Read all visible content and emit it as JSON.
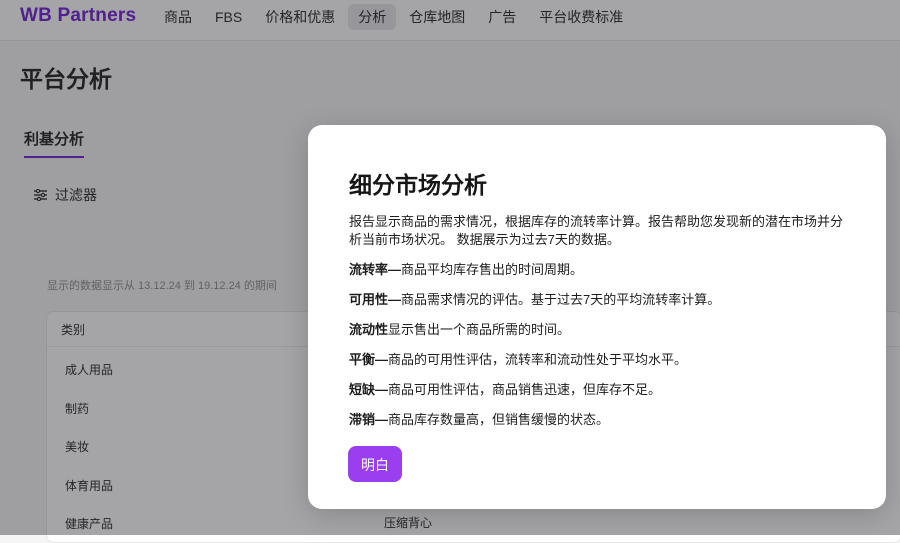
{
  "brand": "WB Partners",
  "nav": [
    {
      "label": "商品",
      "active": false
    },
    {
      "label": "FBS",
      "active": false
    },
    {
      "label": "价格和优惠",
      "active": false
    },
    {
      "label": "分析",
      "active": true
    },
    {
      "label": "仓库地图",
      "active": false
    },
    {
      "label": "广告",
      "active": false
    },
    {
      "label": "平台收费标准",
      "active": false
    }
  ],
  "page": {
    "title": "平台分析",
    "subtab": "利基分析",
    "filter_label": "过滤器",
    "date_note": "显示的数据显示从 13.12.24 到 19.12.24 的期间",
    "table": {
      "header_category": "类别",
      "rows": [
        {
          "category": "成人用品",
          "second": ""
        },
        {
          "category": "制药",
          "second": ""
        },
        {
          "category": "美妆",
          "second": ""
        },
        {
          "category": "体育用品",
          "second": ""
        },
        {
          "category": "健康产品",
          "second": "压缩背心"
        }
      ]
    }
  },
  "modal": {
    "title": "细分市场分析",
    "intro": "报告显示商品的需求情况，根据库存的流转率计算。报告帮助您发现新的潜在市场并分析当前市场状况。 数据展示为过去7天的数据。",
    "definitions": [
      {
        "term": "流转率—",
        "text": "商品平均库存售出的时间周期。"
      },
      {
        "term": "可用性—",
        "text": "商品需求情况的评估。基于过去7天的平均流转率计算。"
      },
      {
        "term": "流动性",
        "text": "显示售出一个商品所需的时间。"
      },
      {
        "term": "平衡—",
        "text": "商品的可用性评估，流转率和流动性处于平均水平。"
      },
      {
        "term": "短缺—",
        "text": "商品可用性评估，商品销售迅速，但库存不足。"
      },
      {
        "term": "滞销—",
        "text": "商品库存数量高，但销售缓慢的状态。"
      }
    ],
    "ok_label": "明白",
    "accent_color": "#9a3ff0"
  }
}
